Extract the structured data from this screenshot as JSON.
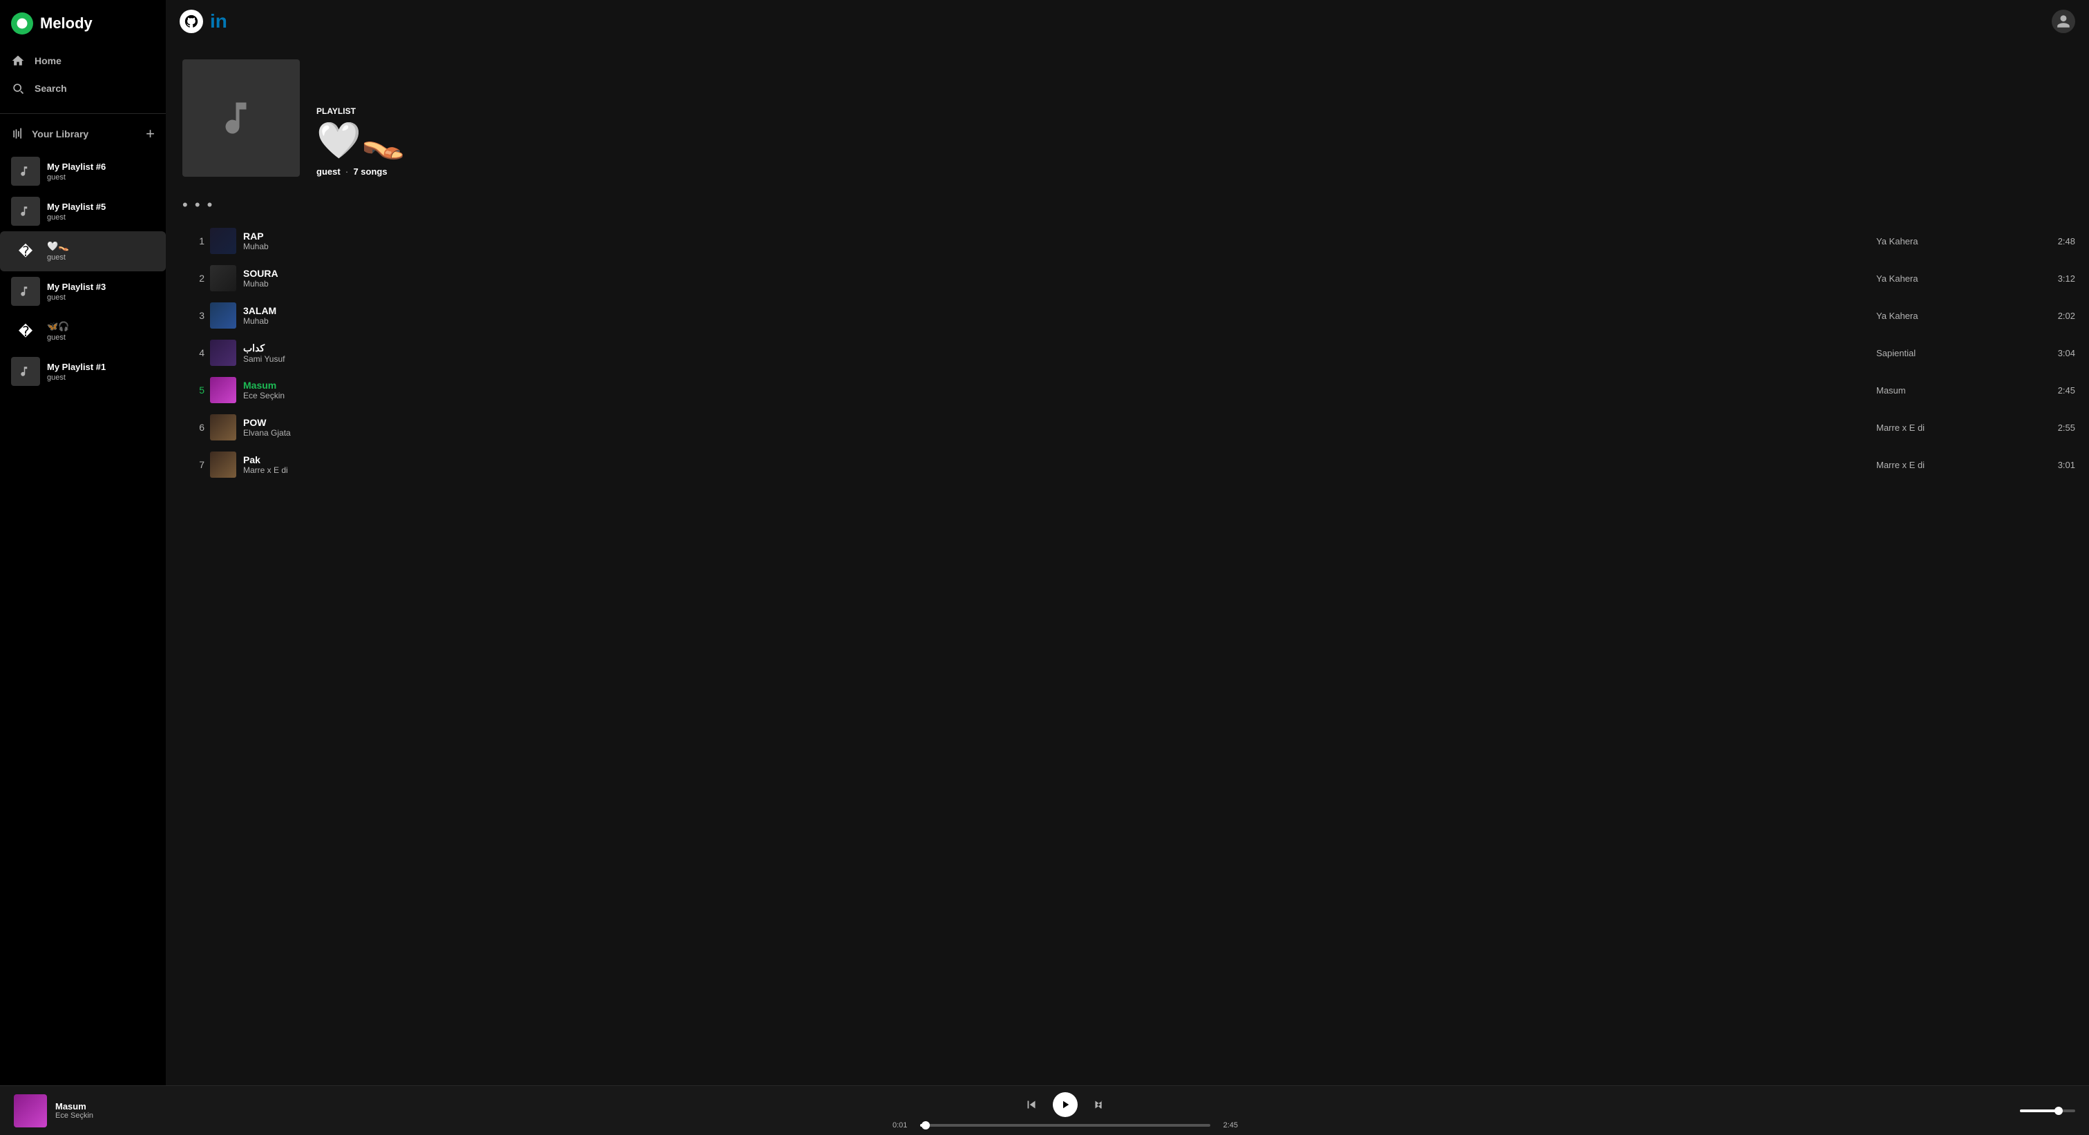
{
  "app": {
    "name": "Melody",
    "logo_label": "Melody"
  },
  "sidebar": {
    "nav": [
      {
        "id": "home",
        "label": "Home",
        "icon": "home-icon"
      },
      {
        "id": "search",
        "label": "Search",
        "icon": "search-icon"
      }
    ],
    "library_title": "Your Library",
    "library_add_label": "+",
    "playlists": [
      {
        "id": "pl6",
        "name": "My Playlist #6",
        "owner": "guest",
        "emoji": null,
        "active": false
      },
      {
        "id": "pl5",
        "name": "My Playlist #5",
        "owner": "guest",
        "emoji": null,
        "active": false
      },
      {
        "id": "heart-ballet",
        "name": "🤍👡",
        "owner": "guest",
        "emoji": "🤍👡",
        "active": true
      },
      {
        "id": "pl3",
        "name": "My Playlist #3",
        "owner": "guest",
        "emoji": null,
        "active": false
      },
      {
        "id": "butterfly",
        "name": "🦋🎧",
        "owner": "guest",
        "emoji": "🦋🎧",
        "active": false
      },
      {
        "id": "pl1",
        "name": "My Playlist #1",
        "owner": "guest",
        "emoji": null,
        "active": false
      }
    ]
  },
  "topbar": {
    "github_label": "GitHub",
    "linkedin_label": "in"
  },
  "playlist_hero": {
    "type": "Playlist",
    "emoji_title": "🤍👡",
    "owner": "guest",
    "song_count": "7 songs"
  },
  "actions": {
    "more_dots": "• • •"
  },
  "tracks": [
    {
      "num": "1",
      "name": "RAP",
      "artist": "Muhab",
      "album": "Ya Kahera",
      "duration": "2:48",
      "playing": false,
      "thumb_class": "thumb-rap"
    },
    {
      "num": "2",
      "name": "SOURA",
      "artist": "Muhab",
      "album": "Ya Kahera",
      "duration": "3:12",
      "playing": false,
      "thumb_class": "thumb-soura"
    },
    {
      "num": "3",
      "name": "3ALAM",
      "artist": "Muhab",
      "album": "Ya Kahera",
      "duration": "2:02",
      "playing": false,
      "thumb_class": "thumb-3alam"
    },
    {
      "num": "4",
      "name": "كداب",
      "artist": "Sami Yusuf",
      "album": "Sapiential",
      "duration": "3:04",
      "playing": false,
      "thumb_class": "thumb-kdab"
    },
    {
      "num": "5",
      "name": "Masum",
      "artist": "Ece Seçkin",
      "album": "Masum",
      "duration": "2:45",
      "playing": true,
      "thumb_class": "thumb-masum"
    },
    {
      "num": "6",
      "name": "POW",
      "artist": "Elvana Gjata",
      "album": "Marre x E di",
      "duration": "2:55",
      "playing": false,
      "thumb_class": "thumb-pow"
    },
    {
      "num": "7",
      "name": "Pak",
      "artist": "Marre x E di",
      "album": "Marre x E di",
      "duration": "3:01",
      "playing": false,
      "thumb_class": "thumb-pak"
    }
  ],
  "player": {
    "now_playing_name": "Masum",
    "now_playing_artist": "Ece Seçkin",
    "current_time": "0:01",
    "total_time": "2:45",
    "progress_pct": 2
  }
}
